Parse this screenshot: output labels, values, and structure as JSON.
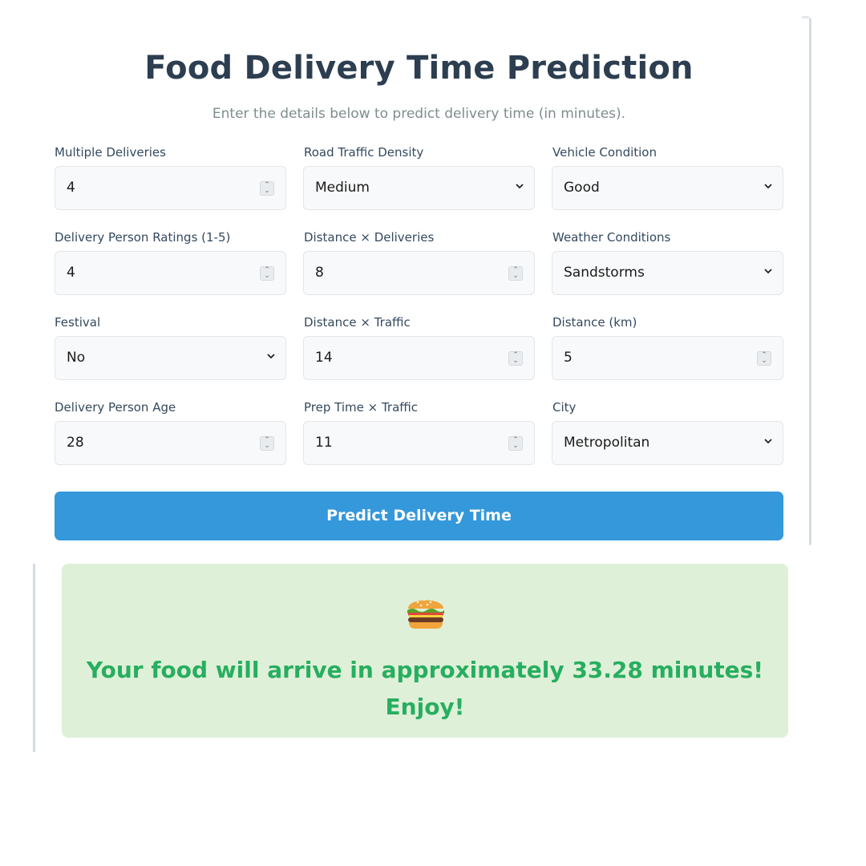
{
  "header": {
    "title": "Food Delivery Time Prediction",
    "subtitle": "Enter the details below to predict delivery time (in minutes)."
  },
  "fields": {
    "multiple_deliveries": {
      "label": "Multiple Deliveries",
      "value": "4"
    },
    "road_traffic_density": {
      "label": "Road Traffic Density",
      "value": "Medium"
    },
    "vehicle_condition": {
      "label": "Vehicle Condition",
      "value": "Good"
    },
    "delivery_person_ratings": {
      "label": "Delivery Person Ratings (1-5)",
      "value": "4"
    },
    "distance_x_deliveries": {
      "label": "Distance × Deliveries",
      "value": "8"
    },
    "weather_conditions": {
      "label": "Weather Conditions",
      "value": "Sandstorms"
    },
    "festival": {
      "label": "Festival",
      "value": "No"
    },
    "distance_x_traffic": {
      "label": "Distance × Traffic",
      "value": "14"
    },
    "distance_km": {
      "label": "Distance (km)",
      "value": "5"
    },
    "delivery_person_age": {
      "label": "Delivery Person Age",
      "value": "28"
    },
    "prep_time_x_traffic": {
      "label": "Prep Time × Traffic",
      "value": "11"
    },
    "city": {
      "label": "City",
      "value": "Metropolitan"
    }
  },
  "actions": {
    "predict_label": "Predict Delivery Time"
  },
  "result": {
    "icon": "burger-icon",
    "line1": "Your food will arrive in approximately 33.28 minutes!",
    "line2": "Enjoy!"
  },
  "colors": {
    "title": "#2c3e50",
    "button": "#3498db",
    "result_bg": "#dff0d8",
    "result_text": "#27ae60"
  }
}
